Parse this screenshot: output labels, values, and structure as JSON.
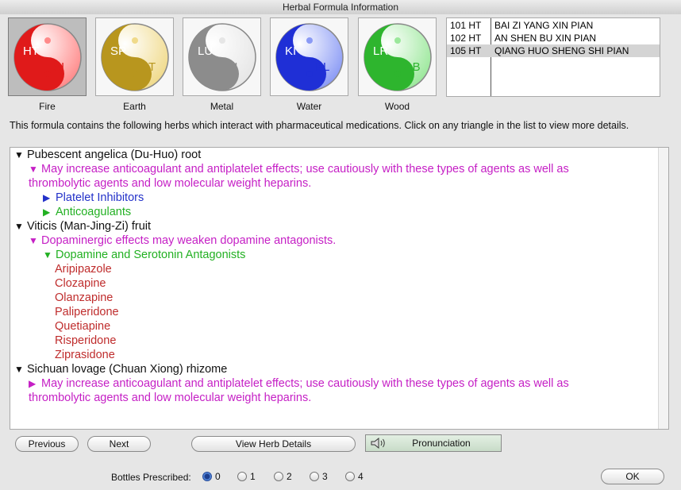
{
  "window": {
    "title": "Herbal Formula Information"
  },
  "elements": [
    {
      "name": "Fire",
      "left": "HT",
      "right": "SI",
      "color": "#e01a1a",
      "light": "#ff8a8a",
      "selected": true
    },
    {
      "name": "Earth",
      "left": "SP",
      "right": "ST",
      "color": "#b8961e",
      "light": "#f0da8a",
      "selected": false
    },
    {
      "name": "Metal",
      "left": "LU",
      "right": "LI",
      "color": "#8c8c8c",
      "light": "#e6e6e6",
      "selected": false
    },
    {
      "name": "Water",
      "left": "KI",
      "right": "BL",
      "color": "#1f2fd6",
      "light": "#8a9af5",
      "selected": false
    },
    {
      "name": "Wood",
      "left": "LR",
      "right": "GB",
      "color": "#2eb52e",
      "light": "#9be89b",
      "selected": false
    }
  ],
  "formulas": [
    {
      "code": "101 HT",
      "name": "BAI ZI YANG XIN PIAN"
    },
    {
      "code": "102 HT",
      "name": "AN SHEN BU XIN PIAN"
    },
    {
      "code": "105 HT",
      "name": "QIANG HUO SHENG SHI PIAN"
    }
  ],
  "instruction": "This formula contains the following herbs which interact with pharmaceutical medications.  Click on any triangle in the list to view more details.",
  "herbs": [
    {
      "name": "Pubescent angelica (Du-Huo) root",
      "effect_line1": "May increase anticoagulant and antiplatelet effects; use cautiously with these types of agents as well as",
      "effect_line2": "thrombolytic agents and low molecular weight heparins.",
      "class1": "Platelet Inhibitors",
      "class2": "Anticoagulants"
    },
    {
      "name": "Viticis (Man-Jing-Zi) fruit",
      "effect": "Dopaminergic effects may weaken dopamine antagonists.",
      "class": "Dopamine and Serotonin Antagonists",
      "drugs": [
        "Aripipazole",
        "Clozapine",
        "Olanzapine",
        "Paliperidone",
        "Quetiapine",
        "Risperidone",
        "Ziprasidone"
      ]
    },
    {
      "name": "Sichuan lovage (Chuan Xiong) rhizome",
      "effect_line1": "May increase anticoagulant and antiplatelet effects; use cautiously with these types of agents as well as",
      "effect_line2": "thrombolytic agents and low molecular weight heparins."
    }
  ],
  "buttons": {
    "previous": "Previous",
    "next": "Next",
    "view_details": "View Herb Details",
    "pronunciation": "Pronunciation",
    "ok": "OK"
  },
  "bottles": {
    "label": "Bottles Prescribed:",
    "options": [
      "0",
      "1",
      "2",
      "3",
      "4"
    ],
    "selected": "0"
  }
}
